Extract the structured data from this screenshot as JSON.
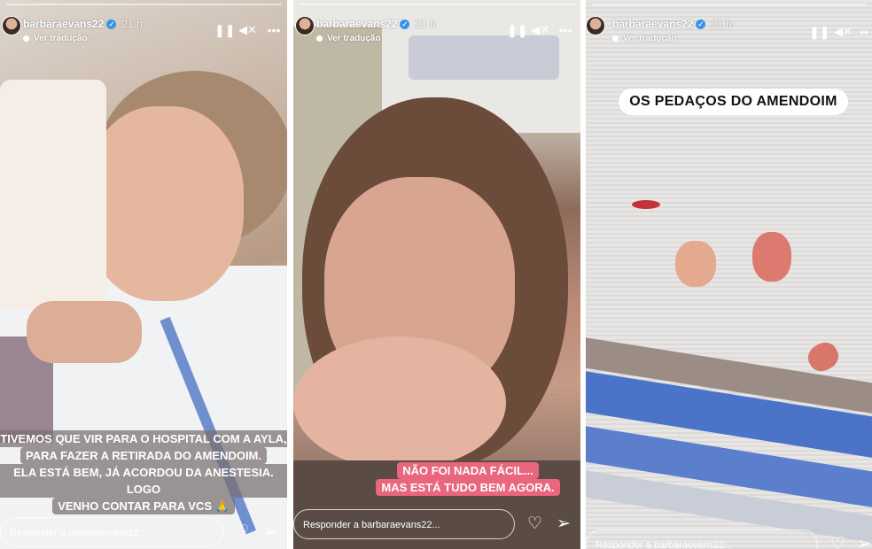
{
  "stories": [
    {
      "username": "barbaraevans22",
      "verified_mark": "✓",
      "time": "21 h",
      "translate_label": "Ver tradução",
      "caption_lines": [
        "TIVEMOS QUE VIR PARA O HOSPITAL COM A AYLA,",
        "PARA FAZER A RETIRADA DO AMENDOIM.",
        "ELA ESTÁ BEM, JÁ ACORDOU DA ANESTESIA. LOGO",
        "VENHO CONTAR PARA VCS 🙏"
      ],
      "reply_placeholder": "Responder a barbaraevans22..."
    },
    {
      "username": "barbaraevans22",
      "verified_mark": "✓",
      "time": "21 h",
      "translate_label": "Ver tradução",
      "caption_lines": [
        "NÃO FOI NADA FÁCIL...",
        "MAS ESTÁ TUDO BEM AGORA."
      ],
      "reply_placeholder": "Responder a barbaraevans22..."
    },
    {
      "username": "barbaraevans22",
      "verified_mark": "✓",
      "time": "21 h",
      "translate_label": "Ver tradução",
      "sticker_text": "OS PEDAÇOS DO AMENDOIM",
      "reply_placeholder": "Responder a barbaraevans22..."
    }
  ],
  "icons": {
    "pause": "pause-icon",
    "mute": "mute-icon",
    "more": "more-icon",
    "heart": "heart-icon",
    "send": "send-icon"
  },
  "colors": {
    "caption_pink": "#e9667d",
    "verified_blue": "#3897f0"
  }
}
